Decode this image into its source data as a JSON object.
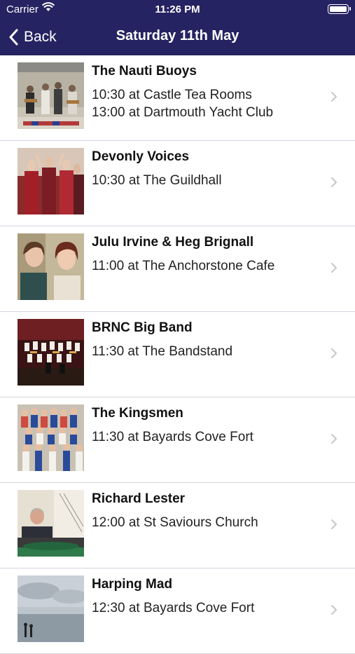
{
  "status_bar": {
    "carrier": "Carrier",
    "time": "11:26 PM"
  },
  "nav": {
    "back_label": "Back",
    "title": "Saturday 11th May"
  },
  "events": [
    {
      "title": "The Nauti Buoys",
      "line1": "10:30 at Castle Tea Rooms",
      "line2": "13:00 at Dartmouth Yacht Club"
    },
    {
      "title": "Devonly Voices",
      "line1": "10:30 at The Guildhall",
      "line2": ""
    },
    {
      "title": "Julu Irvine & Heg Brignall",
      "line1": "11:00 at The Anchorstone Cafe",
      "line2": ""
    },
    {
      "title": "BRNC Big Band",
      "line1": "11:30 at The Bandstand",
      "line2": ""
    },
    {
      "title": "The Kingsmen",
      "line1": "11:30 at Bayards Cove Fort",
      "line2": ""
    },
    {
      "title": "Richard Lester",
      "line1": "12:00 at St Saviours Church",
      "line2": ""
    },
    {
      "title": "Harping Mad",
      "line1": "12:30 at Bayards Cove Fort",
      "line2": ""
    }
  ],
  "colors": {
    "header": "#262362",
    "divider": "#d6d3df",
    "chevron": "#c7c7cc"
  }
}
